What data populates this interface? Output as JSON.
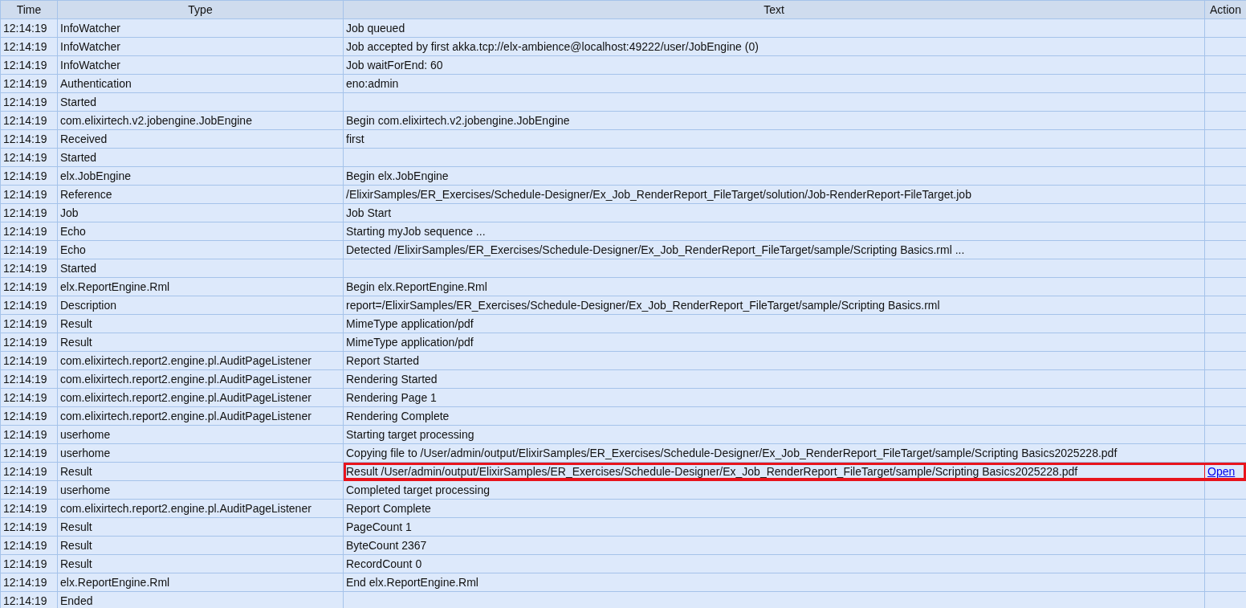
{
  "table": {
    "columns": [
      "Time",
      "Type",
      "Text",
      "Action"
    ],
    "rows": [
      {
        "time": "12:14:19",
        "type": "InfoWatcher",
        "text": "Job queued",
        "highlighted": false
      },
      {
        "time": "12:14:19",
        "type": "InfoWatcher",
        "text": "Job accepted by first akka.tcp://elx-ambience@localhost:49222/user/JobEngine (0)",
        "highlighted": false
      },
      {
        "time": "12:14:19",
        "type": "InfoWatcher",
        "text": "Job waitForEnd: 60",
        "highlighted": false
      },
      {
        "time": "12:14:19",
        "type": "Authentication",
        "text": "eno:admin",
        "highlighted": false
      },
      {
        "time": "12:14:19",
        "type": "Started",
        "highlighted": false
      },
      {
        "time": "12:14:19",
        "type": "com.elixirtech.v2.jobengine.JobEngine",
        "text": "Begin com.elixirtech.v2.jobengine.JobEngine",
        "highlighted": false
      },
      {
        "time": "12:14:19",
        "type": "Received",
        "text": "first",
        "highlighted": false
      },
      {
        "time": "12:14:19",
        "type": "Started",
        "highlighted": false
      },
      {
        "time": "12:14:19",
        "type": "elx.JobEngine",
        "text": "Begin elx.JobEngine",
        "highlighted": false
      },
      {
        "time": "12:14:19",
        "type": "Reference",
        "text": "/ElixirSamples/ER_Exercises/Schedule-Designer/Ex_Job_RenderReport_FileTarget/solution/Job-RenderReport-FileTarget.job",
        "highlighted": false
      },
      {
        "time": "12:14:19",
        "type": "Job",
        "text": "Job Start",
        "highlighted": false
      },
      {
        "time": "12:14:19",
        "type": "Echo",
        "text": "Starting myJob sequence ...",
        "highlighted": false
      },
      {
        "time": "12:14:19",
        "type": "Echo",
        "text": "Detected /ElixirSamples/ER_Exercises/Schedule-Designer/Ex_Job_RenderReport_FileTarget/sample/Scripting Basics.rml ...",
        "highlighted": false
      },
      {
        "time": "12:14:19",
        "type": "Started",
        "highlighted": false
      },
      {
        "time": "12:14:19",
        "type": "elx.ReportEngine.Rml",
        "text": "Begin elx.ReportEngine.Rml",
        "highlighted": false
      },
      {
        "time": "12:14:19",
        "type": "Description",
        "text": "report=/ElixirSamples/ER_Exercises/Schedule-Designer/Ex_Job_RenderReport_FileTarget/sample/Scripting Basics.rml",
        "highlighted": false
      },
      {
        "time": "12:14:19",
        "type": "Result",
        "text": "MimeType application/pdf",
        "highlighted": false
      },
      {
        "time": "12:14:19",
        "type": "Result",
        "text": "MimeType application/pdf",
        "highlighted": false
      },
      {
        "time": "12:14:19",
        "type": "com.elixirtech.report2.engine.pl.AuditPageListener",
        "text": "Report Started",
        "highlighted": false
      },
      {
        "time": "12:14:19",
        "type": "com.elixirtech.report2.engine.pl.AuditPageListener",
        "text": "Rendering Started",
        "highlighted": false
      },
      {
        "time": "12:14:19",
        "type": "com.elixirtech.report2.engine.pl.AuditPageListener",
        "text": "Rendering Page 1",
        "highlighted": false
      },
      {
        "time": "12:14:19",
        "type": "com.elixirtech.report2.engine.pl.AuditPageListener",
        "text": "Rendering Complete",
        "highlighted": false
      },
      {
        "time": "12:14:19",
        "type": "userhome",
        "text": "Starting target processing",
        "highlighted": false
      },
      {
        "time": "12:14:19",
        "type": "userhome",
        "text": "Copying file to /User/admin/output/ElixirSamples/ER_Exercises/Schedule-Designer/Ex_Job_RenderReport_FileTarget/sample/Scripting Basics2025228.pdf",
        "highlighted": false
      },
      {
        "time": "12:14:19",
        "type": "Result",
        "text": "Result /User/admin/output/ElixirSamples/ER_Exercises/Schedule-Designer/Ex_Job_RenderReport_FileTarget/sample/Scripting Basics2025228.pdf",
        "action": "Open",
        "highlighted": true
      },
      {
        "time": "12:14:19",
        "type": "userhome",
        "text": "Completed target processing",
        "highlighted": false
      },
      {
        "time": "12:14:19",
        "type": "com.elixirtech.report2.engine.pl.AuditPageListener",
        "text": "Report Complete",
        "highlighted": false
      },
      {
        "time": "12:14:19",
        "type": "Result",
        "text": "PageCount 1",
        "highlighted": false
      },
      {
        "time": "12:14:19",
        "type": "Result",
        "text": "ByteCount 2367",
        "highlighted": false
      },
      {
        "time": "12:14:19",
        "type": "Result",
        "text": "RecordCount 0",
        "highlighted": false
      },
      {
        "time": "12:14:19",
        "type": "elx.ReportEngine.Rml",
        "text": "End elx.ReportEngine.Rml",
        "highlighted": false
      },
      {
        "time": "12:14:19",
        "type": "Ended",
        "highlighted": false
      }
    ]
  }
}
